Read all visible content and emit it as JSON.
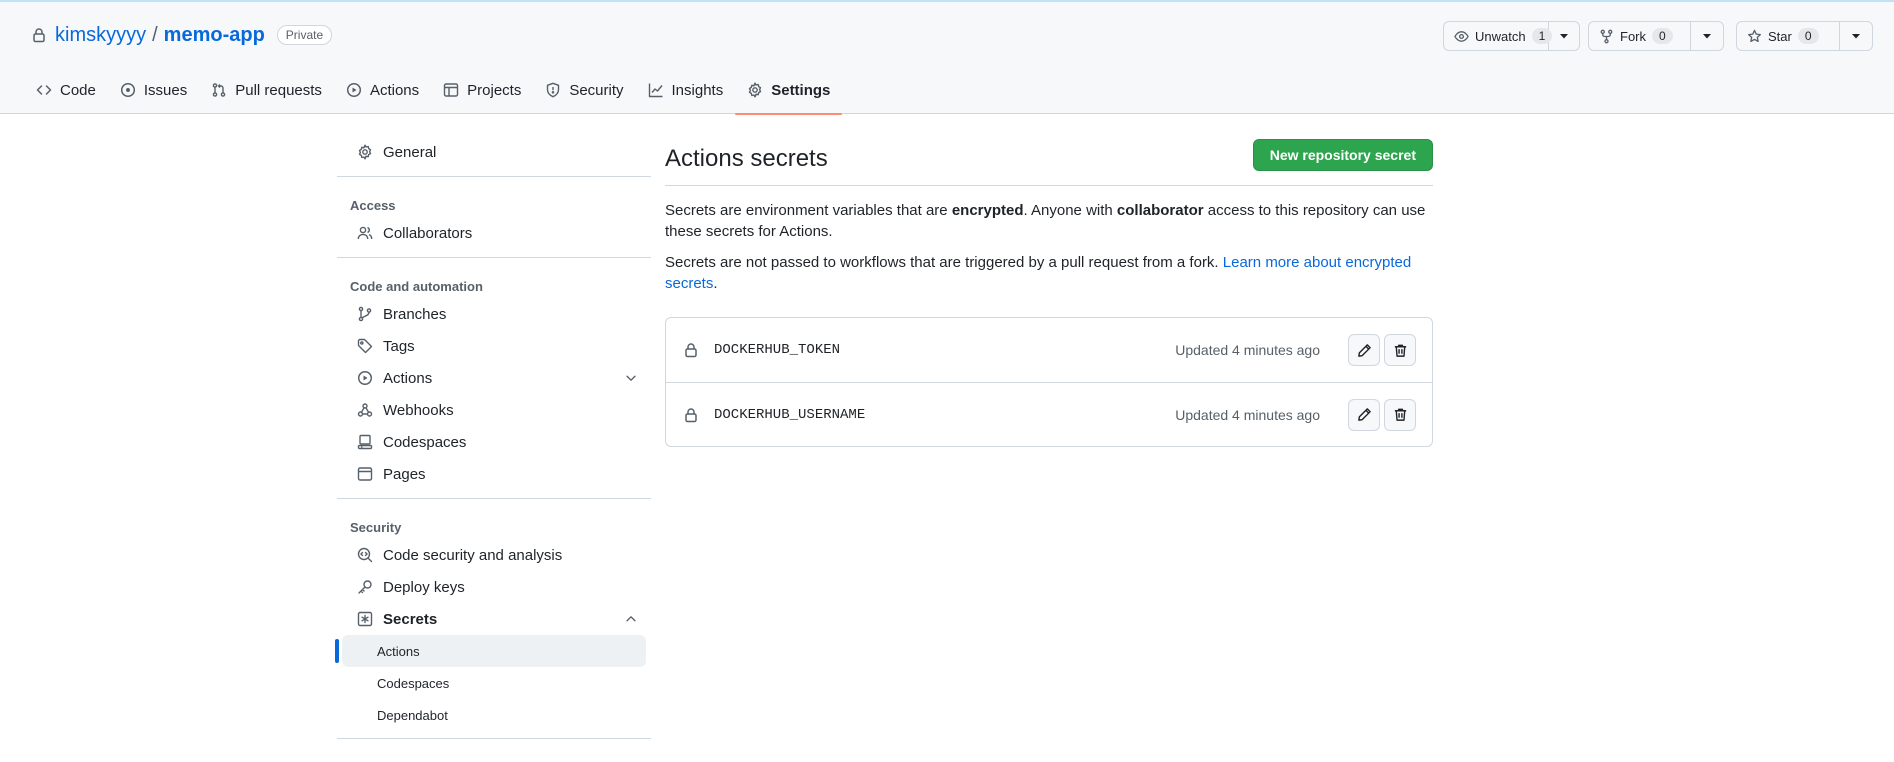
{
  "repo": {
    "owner": "kimskyyyy",
    "separator": "/",
    "name": "memo-app",
    "visibility": "Private"
  },
  "actions": {
    "watch": {
      "label": "Unwatch",
      "count": "1"
    },
    "fork": {
      "label": "Fork",
      "count": "0"
    },
    "star": {
      "label": "Star",
      "count": "0"
    }
  },
  "nav": {
    "tabs": [
      {
        "label": "Code",
        "icon": "code-icon"
      },
      {
        "label": "Issues",
        "icon": "issue-icon"
      },
      {
        "label": "Pull requests",
        "icon": "pull-request-icon"
      },
      {
        "label": "Actions",
        "icon": "play-icon"
      },
      {
        "label": "Projects",
        "icon": "table-icon"
      },
      {
        "label": "Security",
        "icon": "shield-icon"
      },
      {
        "label": "Insights",
        "icon": "graph-icon"
      },
      {
        "label": "Settings",
        "icon": "gear-icon",
        "active": true
      }
    ]
  },
  "sidebar": {
    "general": "General",
    "access_heading": "Access",
    "collaborators": "Collaborators",
    "code_heading": "Code and automation",
    "branches": "Branches",
    "tags": "Tags",
    "actions": "Actions",
    "webhooks": "Webhooks",
    "codespaces": "Codespaces",
    "pages": "Pages",
    "security_heading": "Security",
    "code_security": "Code security and analysis",
    "deploy_keys": "Deploy keys",
    "secrets": "Secrets",
    "secrets_sub": [
      "Actions",
      "Codespaces",
      "Dependabot"
    ]
  },
  "main": {
    "title": "Actions secrets",
    "new_secret_button": "New repository secret",
    "desc1": {
      "t1": "Secrets are environment variables that are ",
      "b1": "encrypted",
      "t2": ". Anyone with ",
      "b2": "collaborator",
      "t3": " access to this repository can use these secrets for Actions."
    },
    "desc2": {
      "t1": "Secrets are not passed to workflows that are triggered by a pull request from a fork. ",
      "link": "Learn more about encrypted secrets",
      "t2": "."
    },
    "secrets": [
      {
        "name": "DOCKERHUB_TOKEN",
        "updated": "Updated 4 minutes ago"
      },
      {
        "name": "DOCKERHUB_USERNAME",
        "updated": "Updated 4 minutes ago"
      }
    ]
  },
  "colors": {
    "link": "#0969da",
    "primary_button": "#2da44e",
    "active_tab_underline": "#fd8c73",
    "sidebar_active_marker": "#0969da"
  }
}
